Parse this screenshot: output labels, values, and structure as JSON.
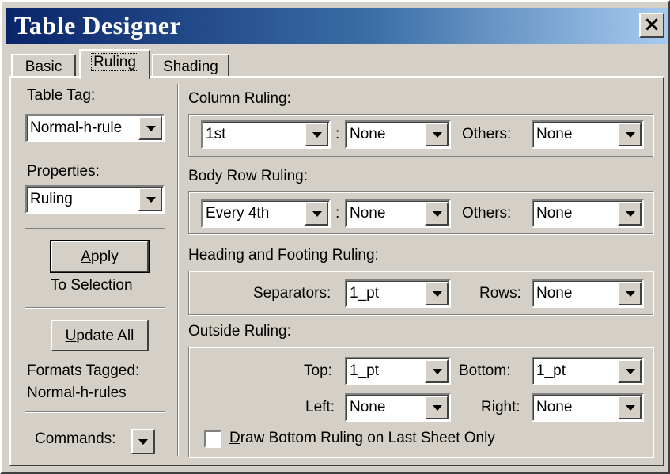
{
  "window": {
    "title": "Table Designer",
    "close_label": "×"
  },
  "tabs": [
    {
      "label": "Basic",
      "active": false
    },
    {
      "label": "Ruling",
      "active": true
    },
    {
      "label": "Shading",
      "active": false
    }
  ],
  "left": {
    "table_tag_label": "Table Tag:",
    "table_tag_value": "Normal-h-rule",
    "properties_label": "Properties:",
    "properties_value": "Ruling",
    "apply_prefix": "A",
    "apply_rest": "pply",
    "to_selection": "To Selection",
    "update_prefix": "U",
    "update_rest": "pdate All",
    "formats_tagged_label": "Formats Tagged:",
    "formats_tagged_value": "Normal-h-rules",
    "commands_label": "Commands:"
  },
  "column_ruling": {
    "label": "Column Ruling:",
    "which": "1st",
    "colon": ":",
    "style": "None",
    "others_label": "Others:",
    "others": "None"
  },
  "body_row_ruling": {
    "label": "Body Row Ruling:",
    "which": "Every 4th",
    "colon": ":",
    "style": "None",
    "others_label": "Others:",
    "others": "None"
  },
  "heading_footing_ruling": {
    "label": "Heading and Footing Ruling:",
    "separators_label": "Separators:",
    "separators": "1_pt",
    "rows_label": "Rows:",
    "rows": "None"
  },
  "outside_ruling": {
    "label": "Outside Ruling:",
    "top_label": "Top:",
    "top": "1_pt",
    "bottom_label": "Bottom:",
    "bottom": "1_pt",
    "left_label": "Left:",
    "left": "None",
    "right_label": "Right:",
    "right": "None",
    "checkbox_prefix": "D",
    "checkbox_rest": "raw Bottom Ruling on Last Sheet Only",
    "checkbox_checked": false
  }
}
